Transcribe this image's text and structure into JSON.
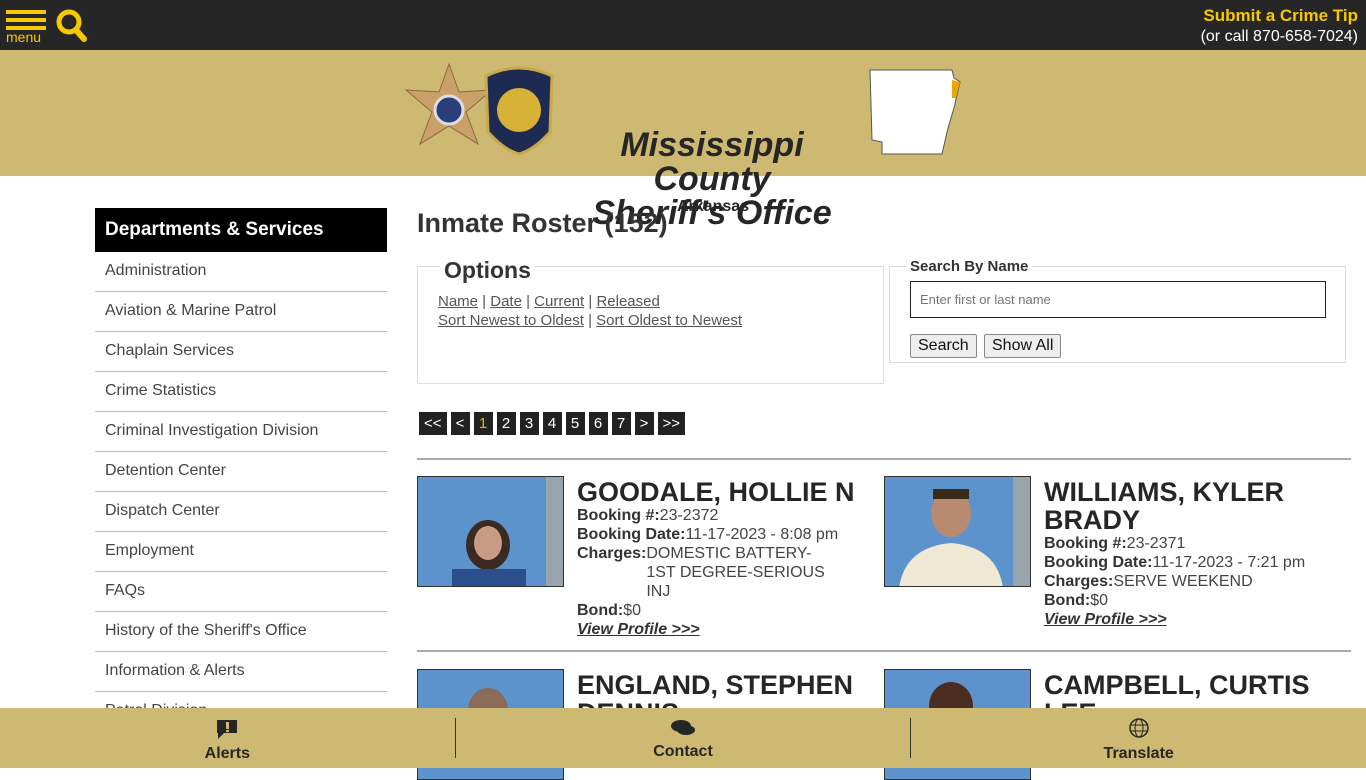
{
  "topbar": {
    "menu_label": "menu",
    "tip_title": "Submit a Crime Tip",
    "tip_phone": "(or call 870-658-7024)"
  },
  "banner": {
    "title_line1": "Mississippi County",
    "title_line2": "Sheriff's Office",
    "state": "Arkansas"
  },
  "sidebar": {
    "heading": "Departments & Services",
    "items": [
      "Administration",
      "Aviation & Marine Patrol",
      "Chaplain Services",
      "Crime Statistics",
      "Criminal Investigation Division",
      "Detention Center",
      "Dispatch Center",
      "Employment",
      "FAQs",
      "History of the Sheriff's Office",
      "Information & Alerts",
      "Patrol Division"
    ]
  },
  "main": {
    "title": "Inmate Roster (152)",
    "options": {
      "legend": "Options",
      "sort_name": "Name",
      "sort_date": "Date",
      "sort_current": "Current",
      "sort_released": "Released",
      "newest": "Sort Newest to Oldest",
      "oldest": "Sort Oldest to Newest"
    },
    "search": {
      "legend": "Search By Name",
      "placeholder": "Enter first or last name",
      "search_label": "Search",
      "show_all_label": "Show All"
    },
    "pager": {
      "first": "<<",
      "prev": "<",
      "pages": [
        "1",
        "2",
        "3",
        "4",
        "5",
        "6",
        "7"
      ],
      "current": "1",
      "next": ">",
      "last": ">>"
    },
    "labels": {
      "booking_no": "Booking #:",
      "booking_date": "Booking Date:",
      "charges": "Charges:",
      "bond": "Bond:",
      "view": "View Profile >>>"
    },
    "inmates": [
      {
        "name": "GOODALE, HOLLIE N",
        "booking_no": "23-2372",
        "booking_date": "11-17-2023 - 8:08 pm",
        "charges": "DOMESTIC BATTERY-1ST DEGREE-SERIOUS INJ",
        "bond": "$0"
      },
      {
        "name": "WILLIAMS, KYLER BRADY",
        "booking_no": "23-2371",
        "booking_date": "11-17-2023 - 7:21 pm",
        "charges": "SERVE WEEKEND",
        "bond": "$0"
      },
      {
        "name": "ENGLAND, STEPHEN DENNIS"
      },
      {
        "name": "CAMPBELL, CURTIS LEE"
      }
    ]
  },
  "footer": {
    "alerts": "Alerts",
    "contact": "Contact",
    "translate": "Translate"
  },
  "colors": {
    "accent": "#f5c800",
    "banner": "#cdb971",
    "topbar": "#262626"
  }
}
